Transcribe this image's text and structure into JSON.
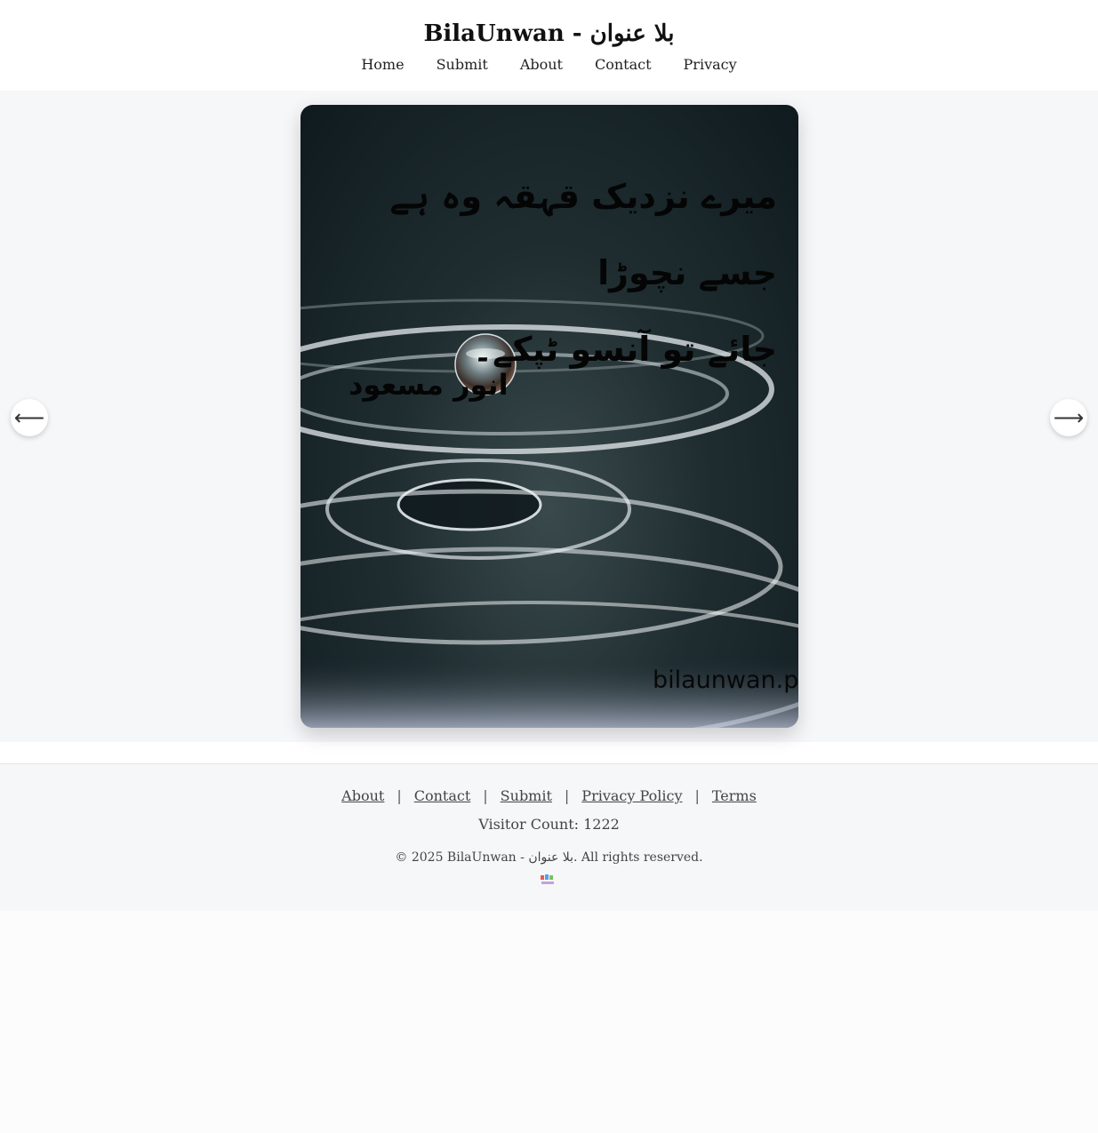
{
  "header": {
    "site_title": "BilaUnwan - بلا عنوان",
    "nav": [
      "Home",
      "Submit",
      "About",
      "Contact",
      "Privacy"
    ]
  },
  "viewer": {
    "quote_line_1": "میرے نزدیک قہقہ وہ ہے جسے نچوڑا",
    "quote_line_2": "جائے تو آنسو ٹپکے۔",
    "author": "انور مسعود",
    "watermark": "bilaunwan.pk",
    "prev_arrow": "⟵",
    "next_arrow": "⟶"
  },
  "footer": {
    "links": [
      "About",
      "Contact",
      "Submit",
      "Privacy Policy",
      "Terms"
    ],
    "separator": "|",
    "visitor_label": "Visitor Count: 1222",
    "copyright": "© 2025 BilaUnwan - بلا عنوان. All rights reserved."
  }
}
